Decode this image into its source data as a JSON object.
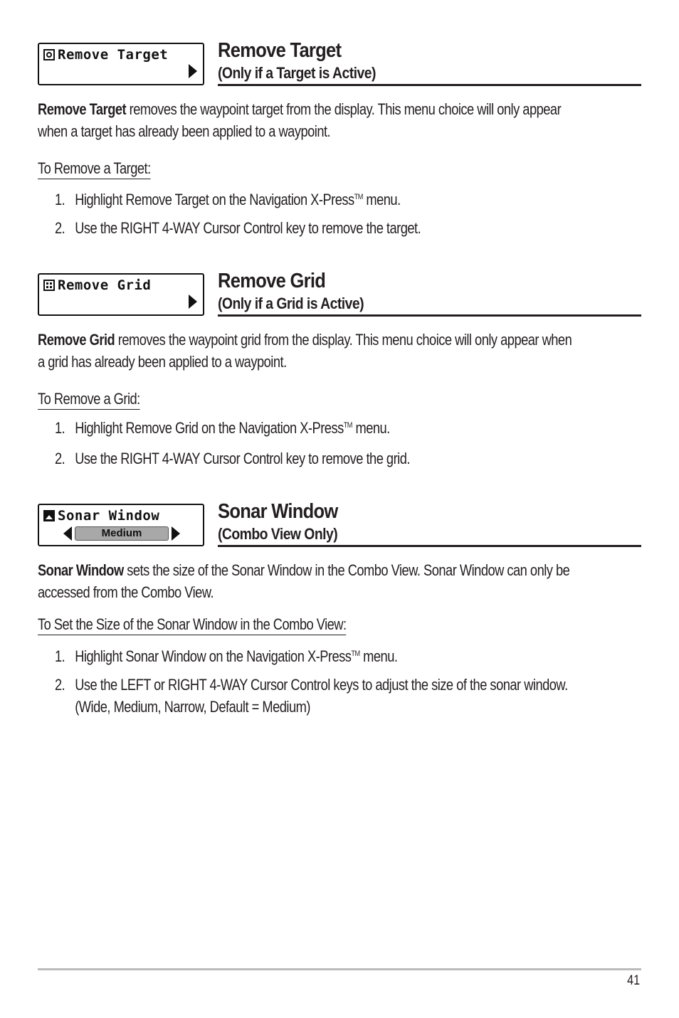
{
  "sections": [
    {
      "menu": {
        "label": "Remove Target",
        "icon": "target-icon",
        "control": "right-arrow"
      },
      "title": "Remove Target",
      "subtitle": "(Only if a Target is Active)",
      "description_bold": "Remove Target",
      "description_line1": " removes the waypoint  target from the display. This menu choice will only appear",
      "description_line2": "when a target has already been applied to a waypoint.",
      "procedure_title": "To Remove a Target:",
      "steps": [
        {
          "num": "1.",
          "text": "Highlight Remove Target on the Navigation X-Press",
          "tm": "TM",
          "after": " menu."
        },
        {
          "num": "2.",
          "text": "Use the RIGHT 4-WAY Cursor Control key to remove the target."
        }
      ]
    },
    {
      "menu": {
        "label": "Remove Grid",
        "icon": "grid-icon",
        "control": "right-arrow"
      },
      "title": "Remove Grid",
      "subtitle": "(Only if a Grid is Active)",
      "description_bold": "Remove Grid",
      "description_line1": " removes the waypoint grid from the display. This menu choice will only appear when",
      "description_line2": "a grid has already been applied to a waypoint.",
      "procedure_title": "To Remove a Grid:",
      "steps": [
        {
          "num": "1.",
          "text": "Highlight Remove Grid on the Navigation X-Press",
          "tm": "TM",
          "after": " menu."
        },
        {
          "num": "2.",
          "text": "Use the RIGHT 4-WAY Cursor Control key to remove the grid."
        }
      ]
    },
    {
      "menu": {
        "label": "Sonar Window",
        "icon": "picture-icon",
        "control": "slider",
        "value": "Medium"
      },
      "title": "Sonar Window",
      "subtitle": "(Combo View Only)",
      "description_bold": "Sonar Window",
      "description_line1": " sets the size of the Sonar Window in the Combo View. Sonar Window can only be",
      "description_line2": "accessed from the Combo View.",
      "procedure_title": "To Set the Size of the Sonar Window in the Combo View:",
      "steps": [
        {
          "num": "1.",
          "text": "Highlight Sonar Window on the Navigation X-Press",
          "tm": "TM",
          "after": " menu."
        },
        {
          "num": "2.",
          "text": "Use the LEFT or RIGHT 4-WAY Cursor Control keys to adjust the size of the sonar window.",
          "cont": "(Wide, Medium, Narrow, Default = Medium)"
        }
      ]
    }
  ],
  "footer": {
    "page_number": "41"
  }
}
